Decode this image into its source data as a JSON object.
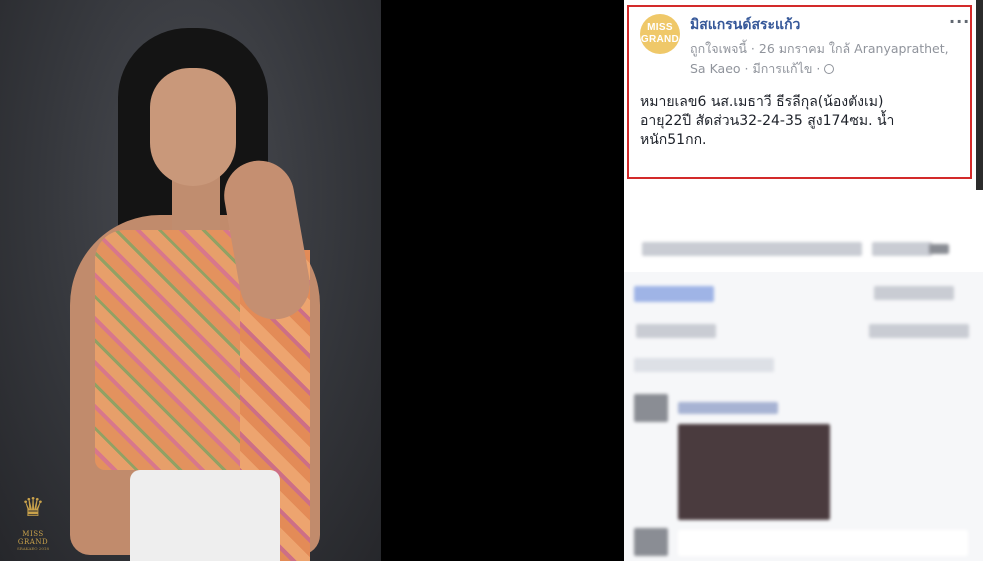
{
  "photo": {
    "logo_text": "MISS GRAND",
    "logo_sub": "SRAKAEO 2018"
  },
  "post": {
    "avatar_line1": "MISS",
    "avatar_line2": "GRAND",
    "page_name": "มิสแกรนด์สระแก้ว",
    "meta_line1": "ถูกใจเพจนี้ · 26 มกราคม ใกล้ Aranyaprathet,",
    "meta_line2": "Sa Kaeo · มีการแก้ไข ·",
    "more_label": "···",
    "text_line1": "หมายเลข6 นส.เมธาวี ธีรลีกุล(น้องตังเม)",
    "text_line2": "อายุ22ปี สัดส่วน32-24-35 สูง174ซม. น้ำ",
    "text_line3": "หนัก51กก."
  },
  "colors": {
    "highlight": "#d32a2a",
    "link": "#365899",
    "avatar": "#efc869"
  }
}
